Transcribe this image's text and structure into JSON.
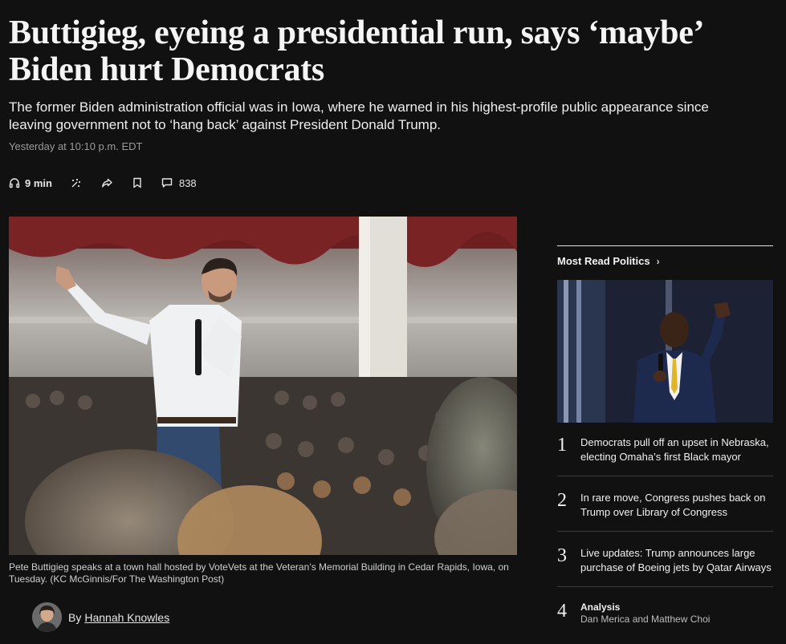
{
  "article": {
    "headline": "Buttigieg, eyeing a presidential run, says ‘maybe’ Biden hurt Democrats",
    "dek": "The former Biden administration official was in Iowa, where he warned in his highest-profile public appearance since leaving government not to ‘hang back’ against President Donald Trump.",
    "timestamp": "Yesterday at 10:10 p.m. EDT",
    "toolbar": {
      "listen_label": "9 min",
      "comments_count": "838"
    },
    "caption": "Pete Buttigieg speaks at a town hall hosted by VoteVets at the Veteran’s Memorial Building in Cedar Rapids, Iowa, on Tuesday. (KC McGinnis/For The Washington Post)",
    "byline": {
      "prefix": "By",
      "author": "Hannah Knowles"
    }
  },
  "sidebar": {
    "title": "Most Read Politics",
    "chevron": "›",
    "items": [
      {
        "number": "1",
        "text": "Democrats pull off an upset in Nebraska, electing Omaha’s first Black mayor"
      },
      {
        "number": "2",
        "text": "In rare move, Congress pushes back on Trump over Library of Congress"
      },
      {
        "number": "3",
        "text": "Live updates: Trump announces large purchase of Boeing jets by Qatar Airways"
      },
      {
        "number": "4",
        "kicker": "Analysis",
        "text": "Dan Merica and Matthew Choi"
      }
    ]
  },
  "icons": {
    "listen": "headphones-icon",
    "gift": "gift-sparkle-icon",
    "share": "share-arrow-icon",
    "save": "bookmark-icon",
    "comments": "comment-bubble-icon"
  },
  "colors": {
    "background": "#111111",
    "text": "#f2f2f2",
    "muted": "#9a9a9a",
    "divider": "#3a3a3a"
  }
}
